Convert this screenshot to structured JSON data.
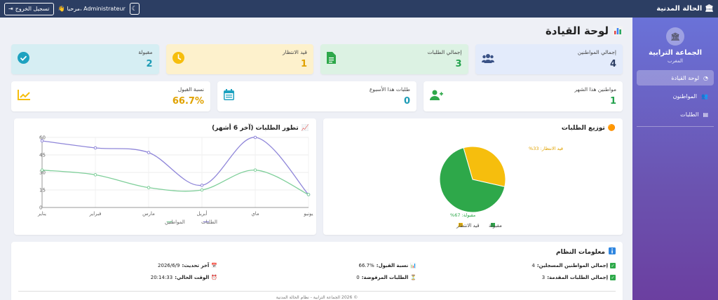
{
  "topbar": {
    "brand": "الحالة المدنية",
    "logout_label": "تسجيل الخروج",
    "greeting": "مرحبا، Administrateur"
  },
  "sidebar": {
    "profile_name": "الجماعة الترابية",
    "profile_sub": "المغرب",
    "items": [
      {
        "label": "لوحة القيادة"
      },
      {
        "label": "المواطنون"
      },
      {
        "label": "الطلبات"
      }
    ]
  },
  "page": {
    "title": "لوحة القيادة"
  },
  "stats": [
    {
      "label": "إجمالي المواطنين",
      "value": "4",
      "color": "#2c3e63",
      "bg": "#e3ebfb",
      "icon": "users-icon"
    },
    {
      "label": "إجمالي الطلبات",
      "value": "3",
      "color": "#23a24d",
      "bg": "#dcf2e3",
      "icon": "document-icon"
    },
    {
      "label": "قيد الانتظار",
      "value": "1",
      "color": "#e0a200",
      "bg": "#fdf1cc",
      "icon": "clock-icon"
    },
    {
      "label": "مقبولة",
      "value": "2",
      "color": "#1c9bb5",
      "bg": "#d6eef3",
      "icon": "check-circle-icon"
    }
  ],
  "stats2": [
    {
      "label": "مواطنين هذا الشهر",
      "value": "1",
      "color": "#23a24d",
      "icon": "user-plus-icon"
    },
    {
      "label": "طلبات هذا الأسبوع",
      "value": "0",
      "color": "#1c9bb5",
      "icon": "calendar-icon"
    },
    {
      "label": "نسبة القبول",
      "value": "66.7%",
      "color": "#e0a200",
      "icon": "chart-line-icon"
    }
  ],
  "line_chart_title": "تطور الطلبات (آخر 6 أشهر)",
  "pie_chart_title": "توزيع الطلبات",
  "chart_data": [
    {
      "type": "line",
      "categories": [
        "يناير",
        "فبراير",
        "مارس",
        "أبريل",
        "ماي",
        "يونيو"
      ],
      "yticks": [
        0,
        15,
        30,
        45,
        60
      ],
      "ylim": [
        0,
        60
      ],
      "series": [
        {
          "name": "الطلبات",
          "color": "#8f86d9",
          "values": [
            57,
            51,
            47,
            19,
            60,
            11
          ]
        },
        {
          "name": "المواطنين",
          "color": "#7fcf9a",
          "values": [
            32,
            28,
            17,
            15,
            32,
            11
          ]
        }
      ],
      "legend_position": "bottom"
    },
    {
      "type": "pie",
      "labels": [
        "مقبولة",
        "قيد الانتظار"
      ],
      "values": [
        67,
        33
      ],
      "colors": [
        "#2ea84a",
        "#f6be0d"
      ],
      "data_labels": [
        "مقبولة: 67%",
        "قيد الانتظار: 33%"
      ],
      "legend_position": "bottom"
    }
  ],
  "info": {
    "title": "معلومات النظام",
    "rows": [
      [
        {
          "icon": "calendar-icon",
          "label": "آخر تحديث:",
          "value": "2026/6/9"
        },
        {
          "icon": "chart-icon",
          "label": "نسبة القبول:",
          "value": "66.7%"
        },
        {
          "icon": "check-icon",
          "label": "إجمالي المواطنين المسجلين:",
          "value": "4"
        }
      ],
      [
        {
          "icon": "alarm-clock-icon",
          "label": "الوقت الحالي:",
          "value": "20:14:33"
        },
        {
          "icon": "hourglass-icon",
          "label": "الطلبات المرفوضة:",
          "value": "0"
        },
        {
          "icon": "check-icon",
          "label": "إجمالي الطلبات المقدمة:",
          "value": "3"
        }
      ]
    ],
    "footer": "© 2026 الجماعة الترابية - نظام الحالة المدنية"
  }
}
